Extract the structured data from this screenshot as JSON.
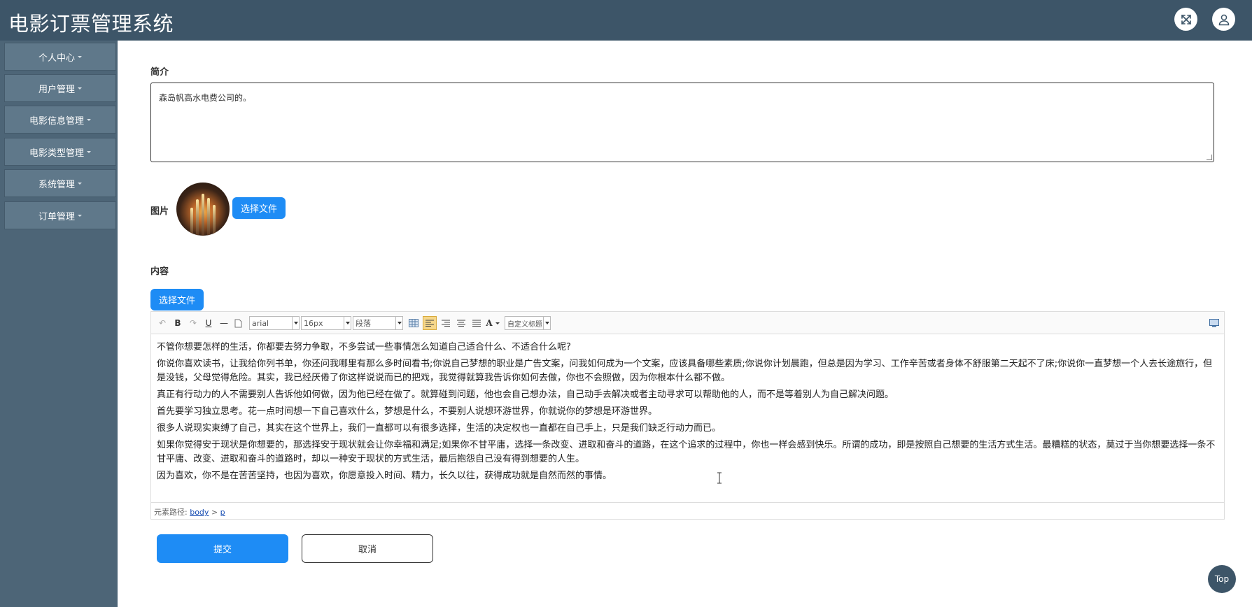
{
  "header": {
    "title": "电影订票管理系统"
  },
  "sidebar": {
    "items": [
      {
        "label": "个人中心"
      },
      {
        "label": "用户管理"
      },
      {
        "label": "电影信息管理"
      },
      {
        "label": "电影类型管理"
      },
      {
        "label": "系统管理"
      },
      {
        "label": "订单管理"
      }
    ]
  },
  "form": {
    "intro_label": "简介",
    "intro_value": "森岛帆高水电费公司的。",
    "image_label": "图片",
    "choose_file_label": "选择文件",
    "content_label": "内容",
    "content_choose_file_label": "选择文件",
    "submit_label": "提交",
    "cancel_label": "取消"
  },
  "editor": {
    "font_family": "arial",
    "font_size": "16px",
    "paragraph": "段落",
    "custom_title": "自定义标题",
    "bold": "B",
    "underline": "U",
    "font_color": "A",
    "path_prefix": "元素路径:",
    "path_body": "body",
    "path_sep": ">",
    "path_p": "p",
    "paragraphs": [
      "不管你想要怎样的生活，你都要去努力争取，不多尝试一些事情怎么知道自己适合什么、不适合什么呢?",
      "你说你喜欢读书，让我给你列书单，你还问我哪里有那么多时间看书;你说自己梦想的职业是广告文案，问我如何成为一个文案，应该具备哪些素质;你说你计划晨跑，但总是因为学习、工作辛苦或者身体不舒服第二天起不了床;你说你一直梦想一个人去长途旅行，但是没钱，父母觉得危险。其实，我已经厌倦了你这样说说而已的把戏，我觉得就算我告诉你如何去做，你也不会照做，因为你根本什么都不做。",
      "真正有行动力的人不需要别人告诉他如何做，因为他已经在做了。就算碰到问题，他也会自己想办法，自己动手去解决或者主动寻求可以帮助他的人，而不是等着别人为自己解决问题。",
      "首先要学习独立思考。花一点时间想一下自己喜欢什么，梦想是什么，不要别人说想环游世界，你就说你的梦想是环游世界。",
      "很多人说现实束缚了自己，其实在这个世界上，我们一直都可以有很多选择，生活的决定权也一直都在自己手上，只是我们缺乏行动力而已。",
      "如果你觉得安于现状是你想要的，那选择安于现状就会让你幸福和满足;如果你不甘平庸，选择一条改变、进取和奋斗的道路，在这个追求的过程中，你也一样会感到快乐。所谓的成功，即是按照自己想要的生活方式生活。最糟糕的状态，莫过于当你想要选择一条不甘平庸、改变、进取和奋斗的道路时，却以一种安于现状的方式生活，最后抱怨自己没有得到想要的人生。",
      "因为喜欢，你不是在苦苦坚持，也因为喜欢，你愿意投入时间、精力，长久以往，获得成功就是自然而然的事情。"
    ]
  },
  "top_button": {
    "label": "Top"
  },
  "icons": {
    "fullscreen": "fullscreen-icon",
    "user": "user-icon"
  },
  "colors": {
    "header_bg": "#3d5568",
    "sidebar_bg": "#4d6577",
    "nav_item_bg": "#5f788a",
    "primary": "#1e8cf5"
  }
}
